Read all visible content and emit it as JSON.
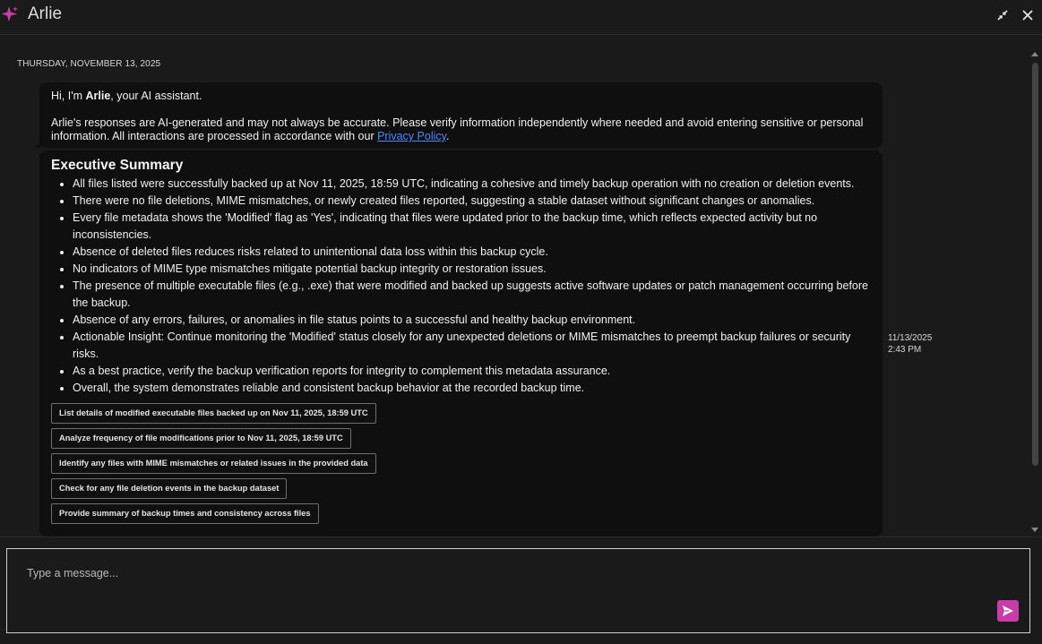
{
  "app": {
    "title": "Arlie",
    "logo_icon": "sparkle-icon",
    "accent_color": "#c73ca9",
    "header_buttons": [
      "minimize-icon",
      "close-icon"
    ]
  },
  "chat": {
    "date_separator": "THURSDAY, NOVEMBER 13, 2025",
    "welcome": {
      "greeting_prefix": "Hi, I'm ",
      "assistant_name": "Arlie",
      "greeting_suffix": ", your AI assistant.",
      "disclaimer": "Arlie's responses are AI-generated and may not always be accurate. Please verify information independently where needed and avoid entering sensitive or personal information. All interactions are processed in accordance with our ",
      "privacy_link": "Privacy Policy",
      "disclaimer_end": "."
    },
    "summary": {
      "title": "Executive Summary",
      "bullets": [
        "All files listed were successfully backed up at Nov 11, 2025, 18:59 UTC, indicating a cohesive and timely backup operation with no creation or deletion events.",
        "There were no file deletions, MIME mismatches, or newly created files reported, suggesting a stable dataset without significant changes or anomalies.",
        "Every file metadata shows the 'Modified' flag as 'Yes', indicating that files were updated prior to the backup time, which reflects expected activity but no inconsistencies.",
        "Absence of deleted files reduces risks related to unintentional data loss within this backup cycle.",
        "No indicators of MIME type mismatches mitigate potential backup integrity or restoration issues.",
        "The presence of multiple executable files (e.g., .exe) that were modified and backed up suggests active software updates or patch management occurring before the backup.",
        "Absence of any errors, failures, or anomalies in file status points to a successful and healthy backup environment.",
        "Actionable Insight: Continue monitoring the 'Modified' status closely for any unexpected deletions or MIME mismatches to preempt backup failures or security risks.",
        "As a best practice, verify the backup verification reports for integrity to complement this metadata assurance.",
        "Overall, the system demonstrates reliable and consistent backup behavior at the recorded backup time."
      ],
      "suggestions": [
        "List details of modified executable files backed up on Nov 11, 2025, 18:59 UTC",
        "Analyze frequency of file modifications prior to Nov 11, 2025, 18:59 UTC",
        "Identify any files with MIME mismatches or related issues in the provided data",
        "Check for any file deletion events in the backup dataset",
        "Provide summary of backup times and consistency across files"
      ],
      "timestamp_date": "11/13/2025",
      "timestamp_time": "2:43 PM"
    }
  },
  "composer": {
    "placeholder": "Type a message...",
    "send_icon": "send-icon"
  }
}
